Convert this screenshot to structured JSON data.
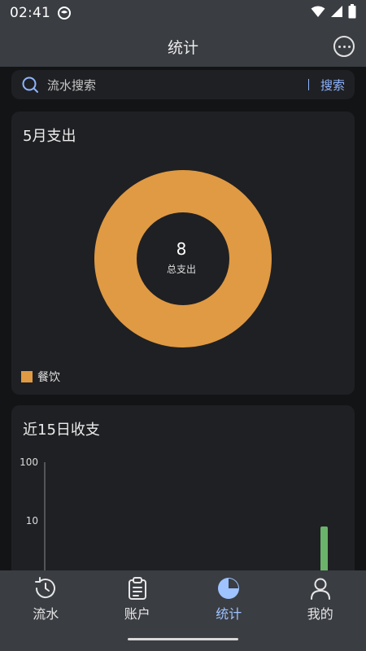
{
  "status_bar": {
    "time": "02:41",
    "icons": [
      "app-notification-icon",
      "wifi-icon",
      "signal-icon",
      "battery-icon"
    ]
  },
  "header": {
    "title": "统计",
    "more_icon": "more-horizontal-icon"
  },
  "search": {
    "placeholder": "流水搜索",
    "button_label": "搜索"
  },
  "expense_card": {
    "title": "5月支出",
    "total_value": "8",
    "total_label": "总支出"
  },
  "trend_card": {
    "title": "近15日收支"
  },
  "tabs": [
    {
      "label": "流水",
      "icon": "clock-icon",
      "active": false
    },
    {
      "label": "账户",
      "icon": "clipboard-icon",
      "active": false
    },
    {
      "label": "统计",
      "icon": "pie-chart-icon",
      "active": true
    },
    {
      "label": "我的",
      "icon": "person-icon",
      "active": false
    }
  ],
  "colors": {
    "accent": "#9ec3ff",
    "donut": "#e09a43",
    "bar": "#6bb36b",
    "background": "#131416",
    "card": "#1f2023",
    "chrome": "#3a3d42"
  },
  "chart_data": [
    {
      "type": "pie",
      "title": "5月支出",
      "categories": [
        "餐饮"
      ],
      "values": [
        8
      ],
      "legend": "bottom-left"
    },
    {
      "type": "bar",
      "title": "近15日收支",
      "y_scale": "log",
      "ylim": [
        1,
        100
      ],
      "y_ticks": [
        "100",
        "10"
      ],
      "series": [
        {
          "values": [
            0,
            0,
            0,
            0,
            0,
            0,
            0,
            0,
            0,
            0,
            0,
            0,
            0,
            0,
            8
          ]
        }
      ]
    }
  ]
}
